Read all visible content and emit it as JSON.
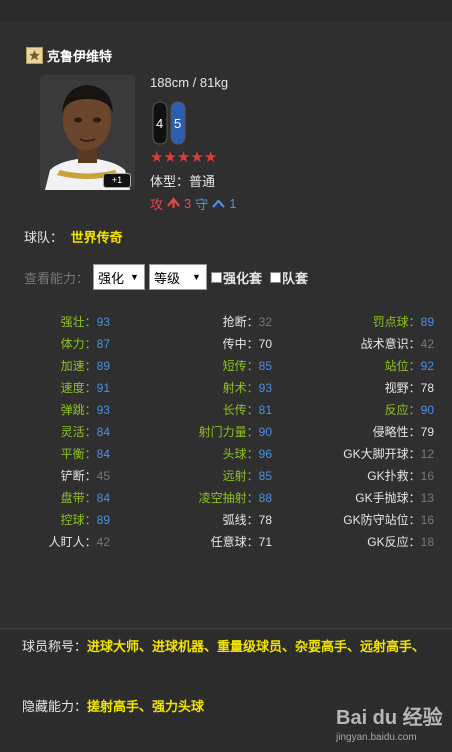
{
  "player": {
    "name": "克鲁伊维特",
    "height_weight": "188cm / 81kg",
    "left_foot": "4",
    "right_foot": "5",
    "stars": 5,
    "body_type": "体型：普通",
    "attack_label": "攻",
    "attack_value": "3",
    "defense_label": "守",
    "defense_value": "1",
    "plus_tag": "+1"
  },
  "team": {
    "label": "球队：",
    "value": "世界传奇"
  },
  "filters": {
    "label": "查看能力：",
    "select1": "强化",
    "select2": "等级",
    "check1": "强化套",
    "check2": "队套"
  },
  "attributes": {
    "col1": [
      {
        "name": "强壮：",
        "value": "93"
      },
      {
        "name": "体力：",
        "value": "87"
      },
      {
        "name": "加速：",
        "value": "89"
      },
      {
        "name": "速度：",
        "value": "91"
      },
      {
        "name": "弹跳：",
        "value": "93"
      },
      {
        "name": "灵活：",
        "value": "84"
      },
      {
        "name": "平衡：",
        "value": "84"
      },
      {
        "name": "铲断：",
        "value": "45"
      },
      {
        "name": "盘带：",
        "value": "84"
      },
      {
        "name": "控球：",
        "value": "89"
      },
      {
        "name": "人盯人：",
        "value": "42"
      }
    ],
    "col2": [
      {
        "name": "抢断：",
        "value": "32"
      },
      {
        "name": "传中：",
        "value": "70"
      },
      {
        "name": "短传：",
        "value": "85"
      },
      {
        "name": "射术：",
        "value": "93"
      },
      {
        "name": "长传：",
        "value": "81"
      },
      {
        "name": "射门力量：",
        "value": "90"
      },
      {
        "name": "头球：",
        "value": "96"
      },
      {
        "name": "远射：",
        "value": "85"
      },
      {
        "name": "凌空抽射：",
        "value": "88"
      },
      {
        "name": "弧线：",
        "value": "78"
      },
      {
        "name": "任意球：",
        "value": "71"
      }
    ],
    "col3": [
      {
        "name": "罚点球：",
        "value": "89"
      },
      {
        "name": "战术意识：",
        "value": "42"
      },
      {
        "name": "站位：",
        "value": "92"
      },
      {
        "name": "视野：",
        "value": "78"
      },
      {
        "name": "反应：",
        "value": "90"
      },
      {
        "name": "侵略性：",
        "value": "79"
      },
      {
        "name": "GK大脚开球：",
        "value": "12"
      },
      {
        "name": "GK扑救：",
        "value": "16"
      },
      {
        "name": "GK手抛球：",
        "value": "13"
      },
      {
        "name": "GK防守站位：",
        "value": "16"
      },
      {
        "name": "GK反应：",
        "value": "18"
      }
    ]
  },
  "traits": {
    "label": "球员称号：",
    "value": "进球大师、进球机器、重量级球员、杂耍高手、远射高手、"
  },
  "hidden": {
    "label": "隐藏能力：",
    "value": "搓射高手、强力头球"
  },
  "watermark": {
    "main": "Bai du 经验",
    "sub": "jingyan.baidu.com"
  },
  "colors": {
    "green_attr": "#8dc21f",
    "blue_value": "#4a90e2",
    "yellow": "#f1e200",
    "star_red": "#e03a3a"
  }
}
